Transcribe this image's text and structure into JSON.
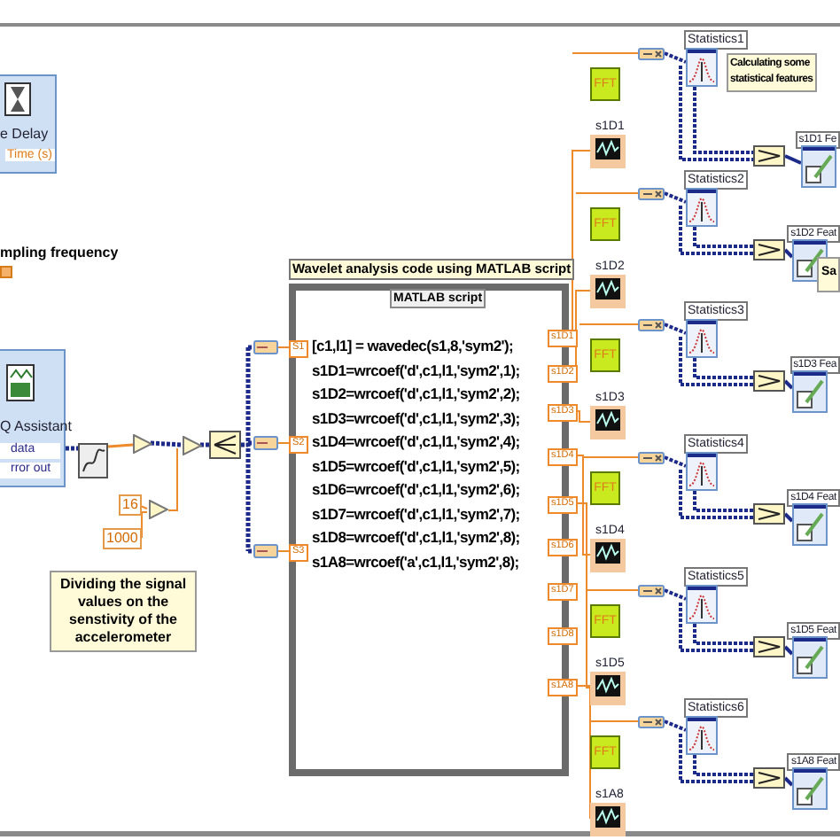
{
  "time_delay": {
    "title": "e Delay",
    "input": "Time (s)"
  },
  "sampling_label": "mpling frequency",
  "daq_assistant": {
    "title": "Q Assistant",
    "terminals": [
      "data",
      "rror out"
    ]
  },
  "constants": [
    "16",
    "1000"
  ],
  "divide_comment": "Dividing the signal values on the senstivity of the accelerometer",
  "script_label": "Wavelet analysis code using MATLAB script",
  "matlab_script": {
    "title": "MATLAB script",
    "inputs": [
      "S1",
      "S2",
      "S3"
    ],
    "code": [
      "[c1,l1] = wavedec(s1,8,'sym2');",
      "s1D1=wrcoef('d',c1,l1,'sym2',1);",
      "s1D2=wrcoef('d',c1,l1,'sym2',2);",
      "s1D3=wrcoef('d',c1,l1,'sym2',3);",
      "s1D4=wrcoef('d',c1,l1,'sym2',4);",
      "s1D5=wrcoef('d',c1,l1,'sym2',5);",
      "s1D6=wrcoef('d',c1,l1,'sym2',6);",
      "s1D7=wrcoef('d',c1,l1,'sym2',7);",
      "s1D8=wrcoef('d',c1,l1,'sym2',8);",
      "s1A8=wrcoef('a',c1,l1,'sym2',8);"
    ],
    "outputs": [
      "s1D1",
      "s1D2",
      "s1D3",
      "s1D4",
      "s1D5",
      "s1D6",
      "s1D7",
      "s1D8",
      "s1A8"
    ]
  },
  "stats_comment": [
    "Calculating some",
    "statistical features"
  ],
  "cut_comment": "Sa",
  "channels": [
    {
      "statistics": "Statistics1",
      "fft": "FFT",
      "graph": "s1D1",
      "feature": "s1D1 Fe"
    },
    {
      "statistics": "Statistics2",
      "fft": "FFT",
      "graph": "s1D2",
      "feature": "s1D2 Feat"
    },
    {
      "statistics": "Statistics3",
      "fft": "FFT",
      "graph": "s1D3",
      "feature": "s1D3 Fea"
    },
    {
      "statistics": "Statistics4",
      "fft": "FFT",
      "graph": "s1D4",
      "feature": "s1D4 Feat"
    },
    {
      "statistics": "Statistics5",
      "fft": "FFT",
      "graph": "s1D5",
      "feature": "s1D5 Feat"
    },
    {
      "statistics": "Statistics6",
      "fft": "FFT",
      "graph": "s1A8",
      "feature": "s1A8 Feat"
    }
  ]
}
